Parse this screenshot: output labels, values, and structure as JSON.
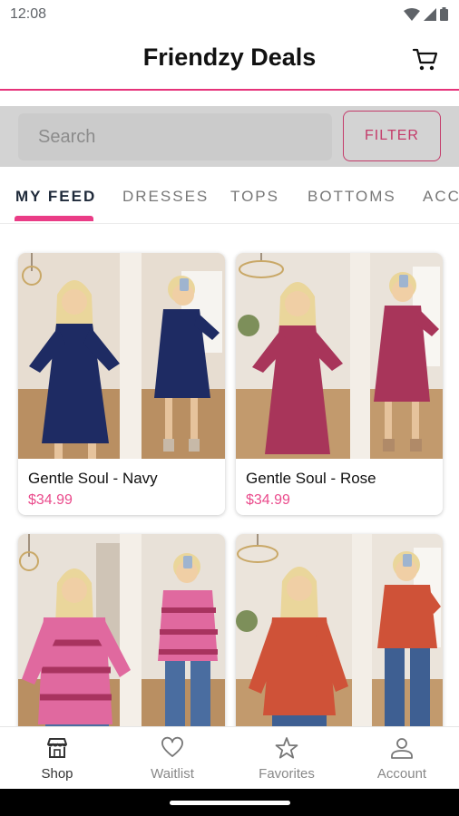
{
  "status": {
    "time": "12:08"
  },
  "app": {
    "title": "Friendzy Deals"
  },
  "search": {
    "placeholder": "Search",
    "filter_label": "FILTER"
  },
  "tabs": [
    {
      "label": "MY FEED",
      "active": true
    },
    {
      "label": "DRESSES"
    },
    {
      "label": "TOPS"
    },
    {
      "label": "BOTTOMS"
    },
    {
      "label": "ACC"
    }
  ],
  "products": [
    {
      "name": "Gentle Soul - Navy",
      "price": "$34.99",
      "color": "#1e2b63"
    },
    {
      "name": "Gentle Soul - Rose",
      "price": "$34.99",
      "color": "#a8355a"
    },
    {
      "name": "",
      "price": "",
      "color": "#e0699f"
    },
    {
      "name": "",
      "price": "",
      "color": "#cf5238"
    }
  ],
  "nav": [
    {
      "label": "Shop",
      "icon": "store-icon"
    },
    {
      "label": "Waitlist",
      "icon": "heart-icon"
    },
    {
      "label": "Favorites",
      "icon": "star-icon"
    },
    {
      "label": "Account",
      "icon": "person-icon"
    }
  ],
  "colors": {
    "accent": "#e6337a",
    "filter": "#c43b6a",
    "price": "#ea4b8c"
  }
}
